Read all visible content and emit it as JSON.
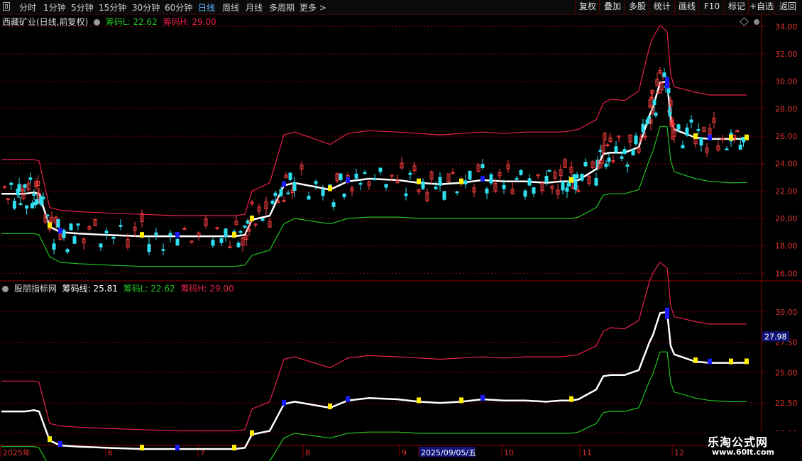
{
  "toolbar": {
    "periods": [
      "分时",
      "1分钟",
      "5分钟",
      "15分钟",
      "30分钟",
      "60分钟",
      "日线",
      "周线",
      "月线",
      "多周期",
      "更多 >"
    ],
    "active_period": "日线",
    "buttons": [
      "复权",
      "叠加",
      "多股",
      "统计",
      "画线",
      "F10",
      "标记",
      "+自选",
      "返回"
    ]
  },
  "main_panel": {
    "stock": "西藏矿业(日线,前复权)",
    "low_label": "筹码L: 22.62",
    "high_label": "筹码H: 29.00",
    "y_ticks": [
      "34.00",
      "32.00",
      "30.00",
      "28.00",
      "26.00",
      "24.00",
      "22.00",
      "20.00",
      "18.00",
      "16.00"
    ]
  },
  "indicator_panel": {
    "name": "股朋指标网",
    "line_label": "筹码线: 25.81",
    "low_label": "筹码L: 22.62",
    "high_label": "筹码H: 29.00",
    "y_ticks": [
      "30.00",
      "27.50",
      "25.00",
      "22.50",
      "20.00"
    ],
    "price_marker": "27.98"
  },
  "x_axis": {
    "labels": [
      "2025年",
      "6",
      "7",
      "8",
      "9",
      "2025/09/05/五",
      "10",
      "11",
      "12"
    ]
  },
  "watermark": {
    "name": "乐淘公式网",
    "url": "www.60lt.com"
  },
  "colors": {
    "upper_band": "#e8204a",
    "lower_band": "#22c322",
    "chip_line": "#ffffff",
    "candle_up": "#ff4040",
    "candle_down": "#2fe0f0",
    "marker_yellow": "#ffee00",
    "marker_blue": "#1a1aff",
    "grid": "#8b0000"
  },
  "chart_data": {
    "type": "line",
    "panels": 2,
    "series": [
      {
        "name": "筹码线",
        "values": [
          21.8,
          21.8,
          21.8,
          21.9,
          21.8,
          19.4,
          19.0,
          18.9,
          18.8,
          18.7,
          18.7,
          18.7,
          18.7,
          18.8,
          19.9,
          20.2,
          22.4,
          22.6,
          22.1,
          22.7,
          22.9,
          22.8,
          22.6,
          22.5,
          22.6,
          22.8,
          22.7,
          22.7,
          22.6,
          22.7,
          22.7,
          22.8,
          23.6,
          24.7,
          24.8,
          24.8,
          25.2,
          27.5,
          28.1,
          29.9,
          30.0,
          27.2,
          26.5,
          25.9,
          25.8,
          25.8,
          25.81
        ]
      },
      {
        "name": "筹码H",
        "values": [
          24.3,
          24.3,
          24.3,
          24.3,
          24.2,
          20.8,
          20.6,
          20.5,
          20.4,
          20.3,
          20.2,
          20.2,
          20.2,
          20.3,
          22.0,
          22.6,
          26.1,
          26.3,
          25.4,
          26.2,
          26.4,
          26.3,
          26.2,
          26.1,
          26.2,
          26.3,
          26.2,
          26.3,
          26.3,
          26.3,
          26.4,
          26.5,
          27.2,
          28.4,
          28.7,
          28.6,
          29.3,
          32.5,
          33.2,
          34.1,
          33.6,
          30.5,
          29.6,
          29.2,
          29.0,
          29.0,
          29.0
        ]
      },
      {
        "name": "筹码L",
        "values": [
          18.9,
          18.9,
          18.9,
          18.9,
          18.8,
          17.2,
          16.8,
          16.7,
          16.6,
          16.5,
          16.5,
          16.5,
          16.5,
          16.6,
          17.3,
          17.7,
          19.6,
          20.0,
          19.6,
          20.0,
          20.1,
          20.1,
          20.0,
          20.0,
          20.0,
          20.0,
          20.0,
          20.0,
          20.0,
          20.0,
          20.0,
          20.1,
          20.8,
          21.7,
          21.8,
          21.8,
          22.1,
          24.3,
          24.9,
          26.7,
          26.7,
          24.2,
          23.4,
          22.9,
          22.7,
          22.6,
          22.62
        ]
      }
    ],
    "ylim_main": [
      15.5,
      34.9
    ],
    "ylim_indicator": [
      19.0,
      32.5
    ]
  }
}
